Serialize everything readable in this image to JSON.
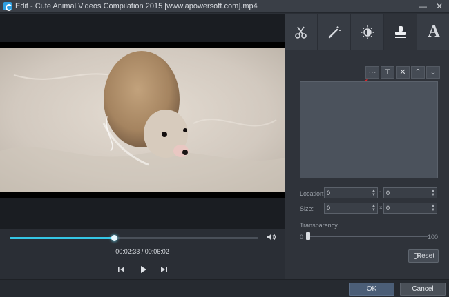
{
  "window": {
    "title": "Edit - Cute Animal Videos Compilation 2015 [www.apowersoft.com].mp4",
    "minimize_glyph": "—",
    "close_glyph": "✕"
  },
  "player": {
    "progress": 0.42,
    "time_display": "00:02:33 / 00:06:02"
  },
  "tabs": [
    {
      "icon": "scissors-icon",
      "active": false
    },
    {
      "icon": "magic-wand-icon",
      "active": false
    },
    {
      "icon": "brightness-icon",
      "active": false
    },
    {
      "icon": "stamp-icon",
      "active": true
    },
    {
      "icon": "text-icon",
      "glyph": "A",
      "active": false
    }
  ],
  "watermark_toolbar": {
    "more_glyph": "···",
    "text_glyph": "T",
    "delete_glyph": "✕",
    "up_glyph": "⌃",
    "down_glyph": "⌄"
  },
  "fields": {
    "location_label": "Location:",
    "location_x": "0",
    "location_sep": ":",
    "location_y": "0",
    "size_label": "Size:",
    "size_w": "0",
    "size_sep": "×",
    "size_h": "0",
    "transparency_label": "Transparency",
    "transparency_min": "0",
    "transparency_max": "100",
    "transparency_value": 0
  },
  "buttons": {
    "reset": "Reset",
    "ok": "OK",
    "cancel": "Cancel"
  },
  "colors": {
    "accent": "#35c6e6",
    "annotation_arrow": "#d9262b"
  }
}
